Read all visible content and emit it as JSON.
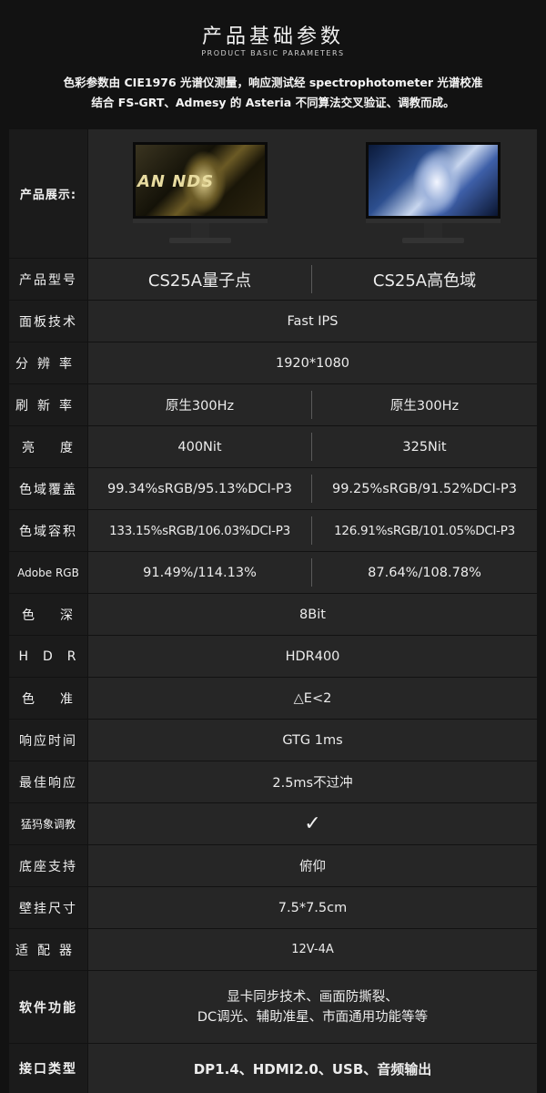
{
  "header": {
    "title": "产品基础参数",
    "subtitle": "PRODUCT BASIC PARAMETERS",
    "desc_line1": "色彩参数由 CIE1976 光谱仪测量，响应测试经 spectrophotometer 光谱校准",
    "desc_line2": "结合 FS-GRT、Admesy 的 Asteria 不同算法交叉验证、调教而成。"
  },
  "showcase": {
    "label": "产品展示:",
    "left_screen_text": "AN    NDS"
  },
  "rows": {
    "model": {
      "label": "产品型号",
      "left": "CS25A量子点",
      "right": "CS25A高色域"
    },
    "panel": {
      "label": "面板技术",
      "value": "Fast IPS"
    },
    "resolution": {
      "label": "分辨率",
      "value": "1920*1080"
    },
    "refresh": {
      "label": "刷新率",
      "left": "原生300Hz",
      "right": "原生300Hz"
    },
    "brightness": {
      "label": "亮度",
      "left": "400Nit",
      "right": "325Nit"
    },
    "coverage": {
      "label": "色域覆盖",
      "left": "99.34%sRGB/95.13%DCI-P3",
      "right": "99.25%sRGB/91.52%DCI-P3"
    },
    "volume": {
      "label": "色域容积",
      "left": "133.15%sRGB/106.03%DCI-P3",
      "right": "126.91%sRGB/101.05%DCI-P3"
    },
    "adobe": {
      "label": "Adobe RGB",
      "left": "91.49%/114.13%",
      "right": "87.64%/108.78%"
    },
    "depth": {
      "label": "色深",
      "value": "8Bit"
    },
    "hdr": {
      "label": "HDR",
      "value": "HDR400"
    },
    "accuracy": {
      "label": "色准",
      "value": "△E<2"
    },
    "response": {
      "label": "响应时间",
      "value": "GTG 1ms"
    },
    "best": {
      "label": "最佳响应",
      "value": "2.5ms不过冲"
    },
    "tuning": {
      "label": "猛犸象调教",
      "value": "✓"
    },
    "stand": {
      "label": "底座支持",
      "value": "俯仰"
    },
    "vesa": {
      "label": "壁挂尺寸",
      "value": "7.5*7.5cm"
    },
    "adapter": {
      "label": "适配器",
      "value": "12V-4A"
    },
    "software": {
      "label": "软件功能",
      "line1": "显卡同步技术、画面防撕裂、",
      "line2": "DC调光、辅助准星、市面通用功能等等"
    },
    "ports": {
      "label": "接口类型",
      "value": "DP1.4、HDMI2.0、USB、音频输出"
    }
  },
  "colors": {
    "background": "#121212",
    "table": "#262626",
    "label_bg": "#1b1b1b"
  }
}
